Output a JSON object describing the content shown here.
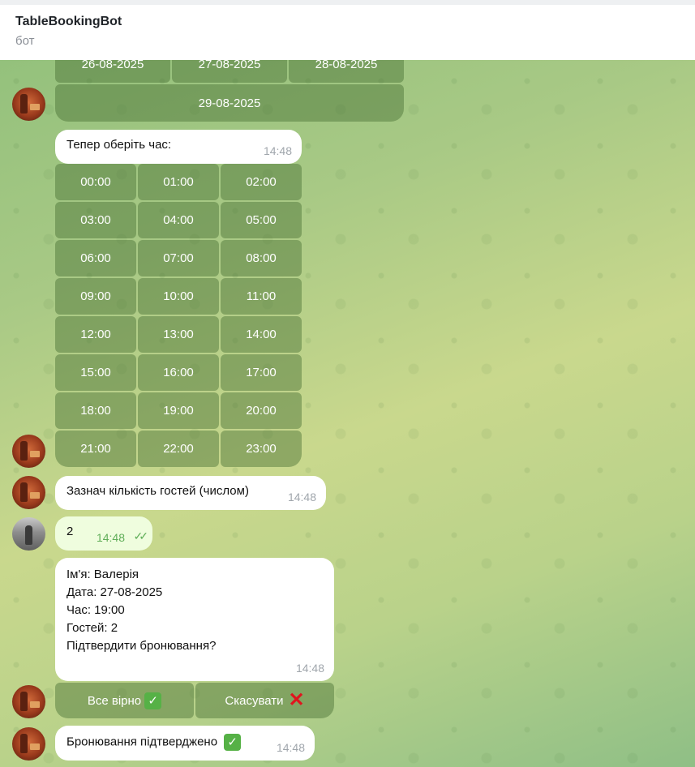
{
  "header": {
    "title": "TableBookingBot",
    "subtitle": "бот"
  },
  "date_keyboard": {
    "row1": [
      "26-08-2025",
      "27-08-2025",
      "28-08-2025"
    ],
    "row2": [
      "29-08-2025"
    ]
  },
  "time_prompt": {
    "text": "Тепер оберіть час:",
    "time": "14:48"
  },
  "time_keyboard": [
    [
      "00:00",
      "01:00",
      "02:00"
    ],
    [
      "03:00",
      "04:00",
      "05:00"
    ],
    [
      "06:00",
      "07:00",
      "08:00"
    ],
    [
      "09:00",
      "10:00",
      "11:00"
    ],
    [
      "12:00",
      "13:00",
      "14:00"
    ],
    [
      "15:00",
      "16:00",
      "17:00"
    ],
    [
      "18:00",
      "19:00",
      "20:00"
    ],
    [
      "21:00",
      "22:00",
      "23:00"
    ]
  ],
  "guests_prompt": {
    "text": "Зазнач кількість гостей (числом)",
    "time": "14:48"
  },
  "user_reply": {
    "text": "2",
    "time": "14:48",
    "status_icon": "double-check-icon"
  },
  "summary": {
    "lines": [
      "Ім'я: Валерія",
      "Дата: 27-08-2025",
      "Час: 19:00",
      "Гостей: 2",
      "",
      "Підтвердити бронювання?"
    ],
    "time": "14:48"
  },
  "confirm_keyboard": {
    "confirm_label": "Все вірно",
    "cancel_label": "Скасувати",
    "confirm_icon": "check-mark-emoji-icon",
    "cancel_icon": "cross-mark-emoji-icon"
  },
  "final_message": {
    "text": "Бронювання підтверджено",
    "time": "14:48",
    "icon": "check-mark-emoji-icon"
  }
}
